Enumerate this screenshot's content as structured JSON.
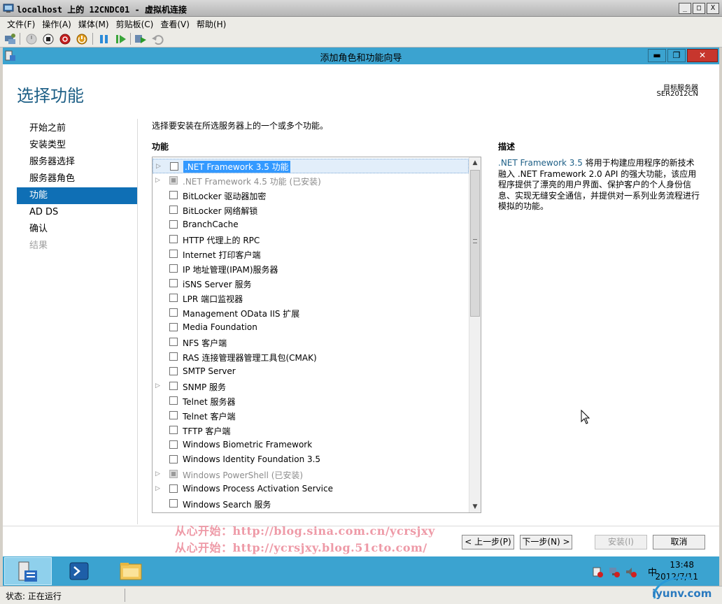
{
  "window": {
    "title": "localhost 上的 12CNDC01 - 虚拟机连接",
    "controls": {
      "minimize": "_",
      "restore": "□",
      "close": "X"
    }
  },
  "menu": [
    "文件(F)",
    "操作(A)",
    "媒体(M)",
    "剪贴板(C)",
    "查看(V)",
    "帮助(H)"
  ],
  "wizard": {
    "title": "添加角色和功能向导",
    "controls": {
      "minimize": "▬",
      "restore": "❐",
      "close": "✕"
    },
    "heading": "选择功能",
    "target_label": "目标服务器",
    "target_server": "SER2012CN",
    "nav": [
      {
        "label": "开始之前",
        "state": "normal"
      },
      {
        "label": "安装类型",
        "state": "normal"
      },
      {
        "label": "服务器选择",
        "state": "normal"
      },
      {
        "label": "服务器角色",
        "state": "normal"
      },
      {
        "label": "功能",
        "state": "active"
      },
      {
        "label": "AD DS",
        "state": "normal"
      },
      {
        "label": "确认",
        "state": "normal"
      },
      {
        "label": "结果",
        "state": "disabled"
      }
    ],
    "instruction": "选择要安装在所选服务器上的一个或多个功能。",
    "features_header": "功能",
    "description_header": "描述",
    "description": {
      "accent": ".NET Framework 3.5",
      "text": " 将用于构建应用程序的新技术融入 .NET Framework 2.0 API 的强大功能，该应用程序提供了漂亮的用户界面、保护客户的个人身份信息、实现无缝安全通信，并提供对一系列业务流程进行模拟的功能。"
    },
    "features": [
      {
        "label": ".NET Framework 3.5 功能",
        "expandable": true,
        "installed": false,
        "selected": true
      },
      {
        "label": ".NET Framework 4.5 功能 (已安装)",
        "expandable": true,
        "installed": true,
        "selected": false
      },
      {
        "label": "BitLocker 驱动器加密",
        "expandable": false,
        "installed": false,
        "selected": false
      },
      {
        "label": "BitLocker 网络解锁",
        "expandable": false,
        "installed": false,
        "selected": false
      },
      {
        "label": "BranchCache",
        "expandable": false,
        "installed": false,
        "selected": false
      },
      {
        "label": "HTTP 代理上的 RPC",
        "expandable": false,
        "installed": false,
        "selected": false
      },
      {
        "label": "Internet 打印客户端",
        "expandable": false,
        "installed": false,
        "selected": false
      },
      {
        "label": "IP 地址管理(IPAM)服务器",
        "expandable": false,
        "installed": false,
        "selected": false
      },
      {
        "label": "iSNS Server 服务",
        "expandable": false,
        "installed": false,
        "selected": false
      },
      {
        "label": "LPR 端口监视器",
        "expandable": false,
        "installed": false,
        "selected": false
      },
      {
        "label": "Management OData IIS 扩展",
        "expandable": false,
        "installed": false,
        "selected": false
      },
      {
        "label": "Media Foundation",
        "expandable": false,
        "installed": false,
        "selected": false
      },
      {
        "label": "NFS 客户端",
        "expandable": false,
        "installed": false,
        "selected": false
      },
      {
        "label": "RAS 连接管理器管理工具包(CMAK)",
        "expandable": false,
        "installed": false,
        "selected": false
      },
      {
        "label": "SMTP Server",
        "expandable": false,
        "installed": false,
        "selected": false
      },
      {
        "label": "SNMP 服务",
        "expandable": true,
        "installed": false,
        "selected": false
      },
      {
        "label": "Telnet 服务器",
        "expandable": false,
        "installed": false,
        "selected": false
      },
      {
        "label": "Telnet 客户端",
        "expandable": false,
        "installed": false,
        "selected": false
      },
      {
        "label": "TFTP 客户端",
        "expandable": false,
        "installed": false,
        "selected": false
      },
      {
        "label": "Windows Biometric Framework",
        "expandable": false,
        "installed": false,
        "selected": false
      },
      {
        "label": "Windows Identity Foundation 3.5",
        "expandable": false,
        "installed": false,
        "selected": false
      },
      {
        "label": "Windows PowerShell (已安装)",
        "expandable": true,
        "installed": true,
        "selected": false
      },
      {
        "label": "Windows Process Activation Service",
        "expandable": true,
        "installed": false,
        "selected": false
      },
      {
        "label": "Windows Search 服务",
        "expandable": false,
        "installed": false,
        "selected": false
      }
    ],
    "buttons": {
      "back": "< 上一步(P)",
      "next": "下一步(N) >",
      "install": "安装(I)",
      "cancel": "取消"
    },
    "watermark": [
      "从心开始：http://blog.sina.com.cn/ycrsjxy",
      "从心开始：http://ycrsjxy.blog.51cto.com/"
    ]
  },
  "taskbar": {
    "ime": "中",
    "time": "13:48",
    "date": "2012/7/11"
  },
  "status": "状态: 正在运行",
  "logo_text": "iyunv.com"
}
